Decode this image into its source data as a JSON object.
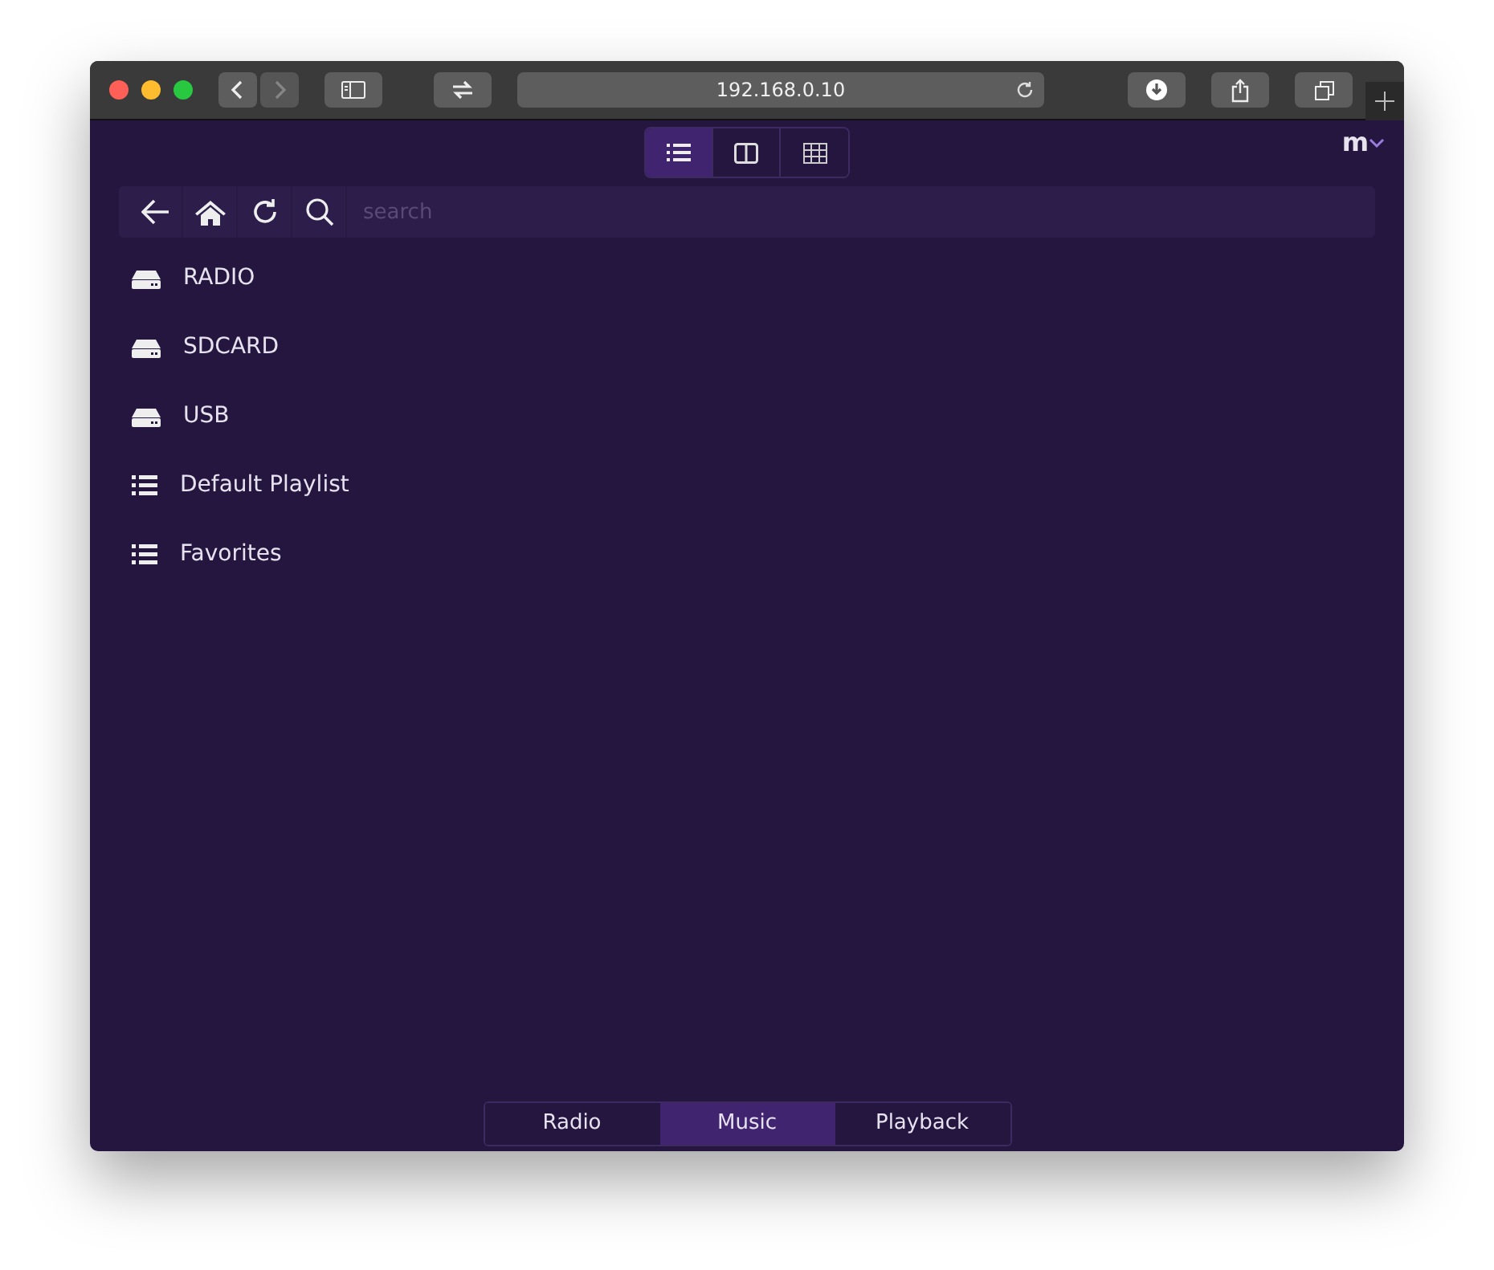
{
  "browser": {
    "url": "192.168.0.10"
  },
  "view_modes": [
    {
      "kind": "list",
      "selected": true
    },
    {
      "kind": "columns",
      "selected": false
    },
    {
      "kind": "grid",
      "selected": false
    }
  ],
  "logo": "m",
  "search": {
    "placeholder": "search"
  },
  "items": [
    {
      "kind": "drive",
      "label": "RADIO"
    },
    {
      "kind": "drive",
      "label": "SDCARD"
    },
    {
      "kind": "drive",
      "label": "USB"
    },
    {
      "kind": "playlist",
      "label": "Default Playlist"
    },
    {
      "kind": "playlist",
      "label": "Favorites"
    }
  ],
  "tabs": [
    {
      "label": "Radio",
      "selected": false
    },
    {
      "label": "Music",
      "selected": true
    },
    {
      "label": "Playback",
      "selected": false
    }
  ]
}
